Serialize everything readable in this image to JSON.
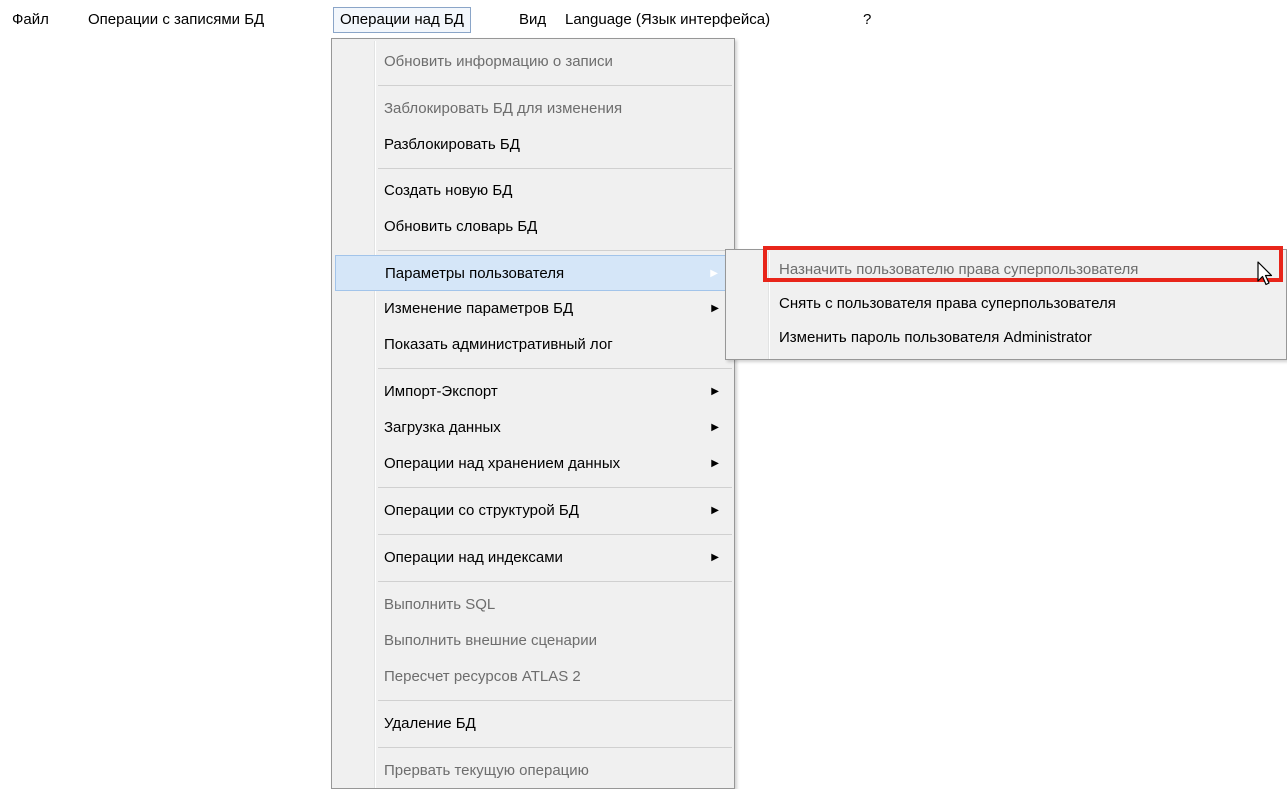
{
  "menubar": {
    "items": [
      {
        "label": "Файл"
      },
      {
        "label": "Операции с записями БД"
      },
      {
        "label": "Операции над БД"
      },
      {
        "label": "Вид"
      },
      {
        "label": "Language (Язык интерфейса)"
      },
      {
        "label": "?"
      }
    ]
  },
  "dropdown": {
    "items": [
      {
        "label": "Обновить информацию о записи"
      },
      {
        "label": "Заблокировать БД для изменения"
      },
      {
        "label": "Разблокировать БД"
      },
      {
        "label": "Создать новую БД"
      },
      {
        "label": "Обновить словарь БД"
      },
      {
        "label": "Параметры пользователя"
      },
      {
        "label": "Изменение параметров БД"
      },
      {
        "label": "Показать  административный лог"
      },
      {
        "label": "Импорт-Экспорт"
      },
      {
        "label": "Загрузка данных"
      },
      {
        "label": "Операции над хранением данных"
      },
      {
        "label": "Операции со структурой БД"
      },
      {
        "label": "Операции над индексами"
      },
      {
        "label": "Выполнить SQL"
      },
      {
        "label": "Выполнить внешние сценарии"
      },
      {
        "label": "Пересчет ресурсов ATLAS 2"
      },
      {
        "label": "Удаление БД"
      },
      {
        "label": "Прервать текущую операцию"
      }
    ]
  },
  "submenu": {
    "items": [
      {
        "label": "Назначить пользователю права суперпользователя"
      },
      {
        "label": "Снять с пользователя права суперпользователя"
      },
      {
        "label": "Изменить пароль пользователя Administrator"
      }
    ]
  },
  "colors": {
    "highlight_border": "#e8251a",
    "hover_bg": "#d5e6f8",
    "disabled_text": "#6d6d6d"
  },
  "icons": {
    "submenu_arrow": "triangle-right-icon",
    "cursor": "mouse-pointer-icon"
  }
}
